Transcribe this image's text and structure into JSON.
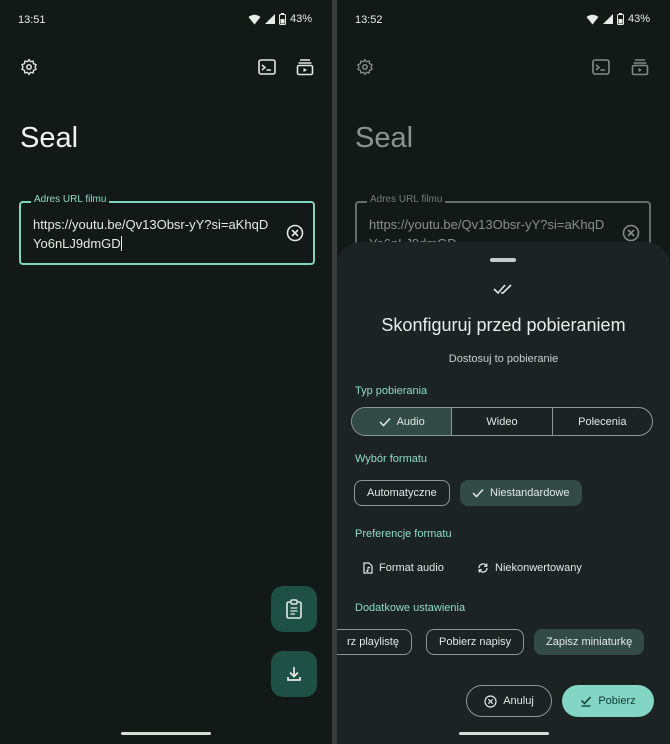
{
  "left": {
    "status": {
      "time": "13:51",
      "battery": "43%"
    },
    "app_title": "Seal",
    "url_field": {
      "label": "Adres URL filmu",
      "value": "https://youtu.be/Qv13Obsr-yY?si=aKhqDYo6nLJ9dmGD"
    },
    "icons": [
      "gear-icon",
      "terminal-icon",
      "subscriptions-icon",
      "clear-icon",
      "clipboard-icon",
      "download-icon"
    ]
  },
  "right": {
    "status": {
      "time": "13:52",
      "battery": "43%"
    },
    "app_title": "Seal",
    "url_field": {
      "label": "Adres URL filmu",
      "value": "https://youtu.be/Qv13Obsr-yY?si=aKhqDYo6nLJ9dmGD"
    },
    "sheet": {
      "title": "Skonfiguruj przed pobieraniem",
      "subtitle": "Dostosuj to pobieranie",
      "download_type": {
        "label": "Typ pobierania",
        "options": [
          "Audio",
          "Wideo",
          "Polecenia"
        ],
        "selected": "Audio"
      },
      "format_choice": {
        "label": "Wybór formatu",
        "options": [
          "Automatyczne",
          "Niestandardowe"
        ],
        "selected": "Niestandardowe"
      },
      "format_prefs": {
        "label": "Preferencje formatu",
        "options": [
          "Format audio",
          "Niekonwertowany"
        ]
      },
      "extra": {
        "label": "Dodatkowe ustawienia",
        "options": [
          "rz playlistę",
          "Pobierz napisy",
          "Zapisz miniaturkę"
        ],
        "selected": "Zapisz miniaturkę"
      },
      "cancel_label": "Anuluj",
      "download_label": "Pobierz"
    }
  },
  "colors": {
    "background": "#131917",
    "accent": "#82d6c3",
    "sheet": "#1b2422",
    "chip_selected": "#334b46",
    "fab": "#1e5046"
  }
}
